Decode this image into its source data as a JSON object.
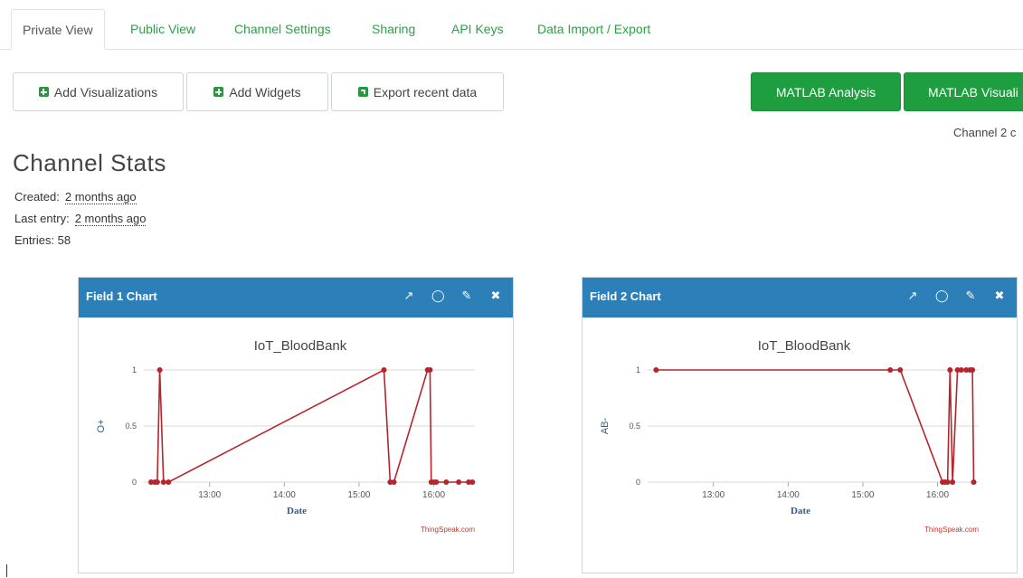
{
  "tabs": [
    {
      "label": "Private View",
      "active": true
    },
    {
      "label": "Public View"
    },
    {
      "label": "Channel Settings"
    },
    {
      "label": "Sharing"
    },
    {
      "label": "API Keys"
    },
    {
      "label": "Data Import / Export"
    }
  ],
  "toolbar": {
    "add_visualizations": "Add Visualizations",
    "add_widgets": "Add Widgets",
    "export_recent": "Export recent data",
    "matlab_analysis": "MATLAB Analysis",
    "matlab_visualization": "MATLAB Visuali"
  },
  "channel_note": "Channel 2 c",
  "stats": {
    "title": "Channel Stats",
    "created_label": "Created:",
    "created_value": "2 months ago",
    "last_entry_label": "Last entry:",
    "last_entry_value": "2 months ago",
    "entries_label": "Entries: 58"
  },
  "colors": {
    "accent_green": "#1e9e3e",
    "card_header": "#2d7fb8",
    "series": "#b5252b",
    "axis_label": "#2d5f9a"
  },
  "chart_data": [
    {
      "type": "line",
      "card_title": "Field 1 Chart",
      "title": "IoT_BloodBank",
      "xlabel": "Date",
      "ylabel": "O+",
      "credit": "ThingSpeak.com",
      "xticks": [
        "13:00",
        "14:00",
        "15:00",
        "16:00"
      ],
      "yticks": [
        "0",
        "0.5",
        "1"
      ],
      "ylim": [
        0,
        1
      ],
      "xlim": [
        "12:13",
        "16:33"
      ],
      "x": [
        "12:13",
        "12:16",
        "12:18",
        "12:20",
        "12:23",
        "12:27",
        "15:20",
        "15:25",
        "15:28",
        "15:55",
        "15:57",
        "15:58",
        "16:00",
        "16:02",
        "16:10",
        "16:20",
        "16:28",
        "16:31"
      ],
      "y": [
        0,
        0,
        0,
        1,
        0,
        0,
        1,
        0,
        0,
        1,
        1,
        0,
        0,
        0,
        0,
        0,
        0,
        0
      ],
      "icons": [
        "external-link-icon",
        "comment-icon",
        "edit-icon",
        "close-icon"
      ]
    },
    {
      "type": "line",
      "card_title": "Field 2 Chart",
      "title": "IoT_BloodBank",
      "xlabel": "Date",
      "ylabel": "AB-",
      "credit": "ThingSpeak.com",
      "xticks": [
        "13:00",
        "14:00",
        "15:00",
        "16:00"
      ],
      "yticks": [
        "0",
        "0.5",
        "1"
      ],
      "ylim": [
        0,
        1
      ],
      "xlim": [
        "12:13",
        "16:33"
      ],
      "x": [
        "12:14",
        "15:22",
        "15:30",
        "16:04",
        "16:06",
        "16:08",
        "16:10",
        "16:12",
        "16:16",
        "16:19",
        "16:23",
        "16:26",
        "16:28",
        "16:29"
      ],
      "y": [
        1,
        1,
        1,
        0,
        0,
        0,
        1,
        0,
        1,
        1,
        1,
        1,
        1,
        0
      ],
      "icons": [
        "external-link-icon",
        "comment-icon",
        "edit-icon",
        "close-icon"
      ]
    }
  ]
}
